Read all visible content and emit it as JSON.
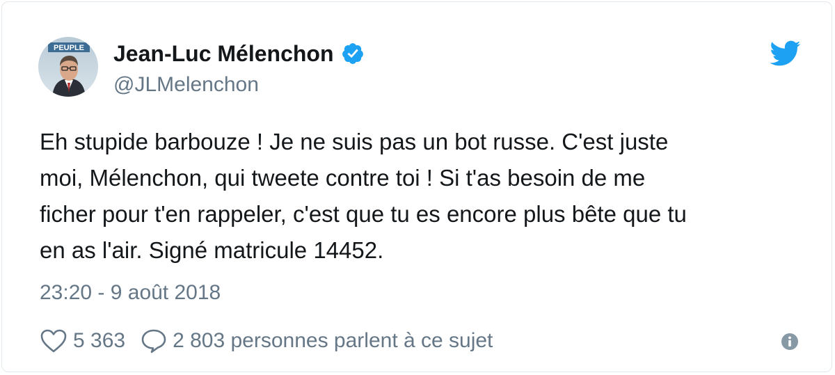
{
  "author": {
    "display_name": "Jean-Luc Mélenchon",
    "handle": "@JLMelenchon",
    "verified": true,
    "avatar_banner_text": "PEUPLE"
  },
  "tweet": {
    "text_lines": [
      "Eh stupide barbouze ! Je ne suis pas un bot russe. C'est juste",
      "moi, Mélenchon, qui tweete contre toi ! Si t'as besoin de me",
      "ficher pour t'en rappeler, c'est que tu es encore plus bête que tu",
      "en as l'air. Signé matricule 14452."
    ],
    "timestamp": "23:20 - 9 août 2018"
  },
  "actions": {
    "like_count": "5 363",
    "reply_text": "2 803 personnes parlent à ce sujet"
  },
  "icons": {
    "brand": "twitter-bird-icon",
    "verified": "verified-badge-icon",
    "like": "heart-icon",
    "reply": "speech-bubble-icon",
    "info": "info-icon"
  },
  "colors": {
    "twitter_blue": "#1da1f2",
    "text_primary": "#14171a",
    "text_secondary": "#657786",
    "border": "#e1e8ed"
  }
}
